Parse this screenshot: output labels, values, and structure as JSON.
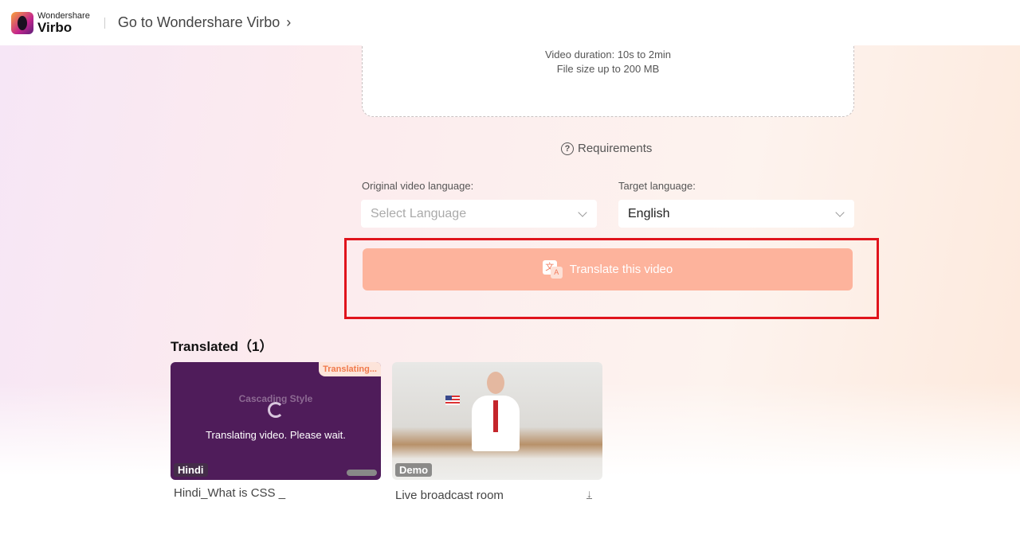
{
  "header": {
    "brand_small": "Wondershare",
    "brand_big": "Virbo",
    "goto_label": "Go to Wondershare Virbo"
  },
  "upload": {
    "duration": "Video duration: 10s to 2min",
    "size": "File size up to 200 MB"
  },
  "requirements": "Requirements",
  "original_language": {
    "label": "Original video language:",
    "placeholder": "Select Language"
  },
  "target_language": {
    "label": "Target language:",
    "value": "English"
  },
  "translate_button": "Translate this video",
  "translated": {
    "title": "Translated（1）",
    "items": [
      {
        "badge": "Translating...",
        "thumb_text": "Cascading Style",
        "status": "Translating video. Please wait.",
        "tag": "Hindi",
        "name": "Hindi_What is CSS _"
      },
      {
        "tag": "Demo",
        "name": "Live broadcast room"
      }
    ]
  },
  "colors": {
    "accent_button": "#fdb39c",
    "highlight_frame": "#e0141c"
  }
}
